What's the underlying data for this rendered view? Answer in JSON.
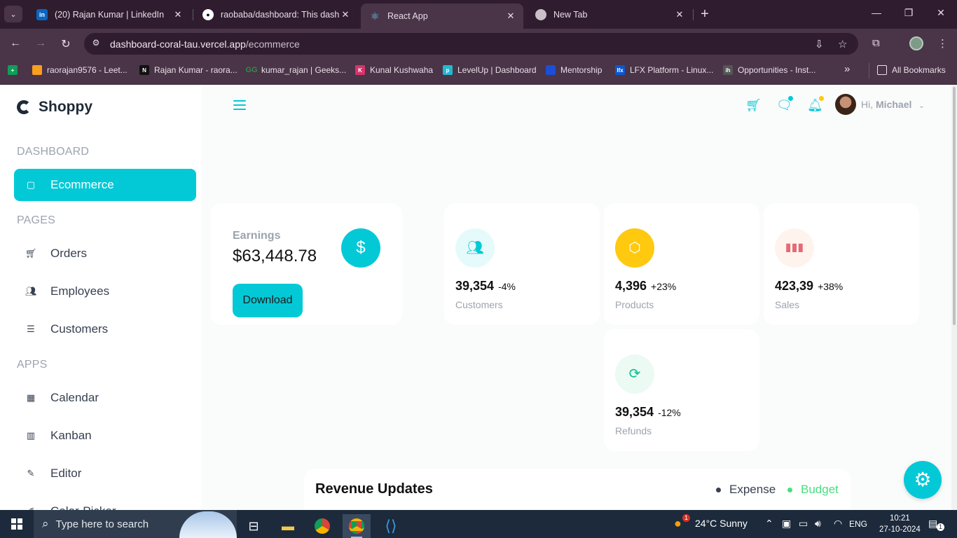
{
  "browser": {
    "tabs": [
      {
        "title": "(20) Rajan Kumar | LinkedIn",
        "icon": "linkedin-icon"
      },
      {
        "title": "raobaba/dashboard: This dashb",
        "icon": "github-icon"
      },
      {
        "title": "React App",
        "icon": "react-icon"
      },
      {
        "title": "New Tab",
        "icon": "chrome-icon"
      }
    ],
    "url_host": "dashboard-coral-tau.vercel.app",
    "url_path": "/ecommerce",
    "bookmarks": [
      {
        "label": "raorajan9576 - Leet...",
        "color": "#f89f1b"
      },
      {
        "label": "Rajan Kumar - raora...",
        "color": "#111111"
      },
      {
        "label": "kumar_rajan | Geeks...",
        "color": "#2f8d46"
      },
      {
        "label": "Kunal Kushwaha",
        "color": "#d6336c"
      },
      {
        "label": "LevelUp | Dashboard",
        "color": "#22b8cf"
      },
      {
        "label": "Mentorship",
        "color": "#1c4ed8"
      },
      {
        "label": "LFX Platform - Linux...",
        "color": "#0b57d0"
      },
      {
        "label": "Opportunities - Inst...",
        "color": "#555555"
      }
    ],
    "all_bookmarks": "All Bookmarks",
    "bm_overflow": "»"
  },
  "app": {
    "brand": "Shoppy",
    "sidebar": {
      "sections": {
        "dashboard": "DASHBOARD",
        "pages": "PAGES",
        "apps": "APPS"
      },
      "items": {
        "ecommerce": "Ecommerce",
        "orders": "Orders",
        "employees": "Employees",
        "customers": "Customers",
        "calendar": "Calendar",
        "kanban": "Kanban",
        "editor": "Editor",
        "color_picker": "Color-Picker"
      }
    },
    "navbar": {
      "greeting": "Hi,",
      "user": "Michael"
    },
    "earnings": {
      "label": "Earnings",
      "value": "$63,448.78",
      "button": "Download",
      "icon": "$"
    },
    "stats": [
      {
        "amount": "39,354",
        "percent": "-4%",
        "title": "Customers",
        "icon": "customers-icon",
        "icon_color": "#03c9d7",
        "icon_bg": "#e5fafb",
        "pct_color": "#111111"
      },
      {
        "amount": "4,396",
        "percent": "+23%",
        "title": "Products",
        "icon": "box-icon",
        "icon_color": "#ffffff",
        "icon_bg": "#fec90f",
        "pct_color": "#111111"
      },
      {
        "amount": "423,39",
        "percent": "+38%",
        "title": "Sales",
        "icon": "bar-chart-icon",
        "icon_color": "#e46a76",
        "icon_bg": "#fff4ed",
        "pct_color": "#111111"
      },
      {
        "amount": "39,354",
        "percent": "-12%",
        "title": "Refunds",
        "icon": "refresh-icon",
        "icon_color": "#00c292",
        "icon_bg": "#ebfaf2",
        "pct_color": "#111111"
      }
    ],
    "revenue": {
      "title": "Revenue Updates",
      "legend_expense": "Expense",
      "legend_budget": "Budget"
    },
    "colors": {
      "accent": "#03c9d7",
      "budget": "#4ade80",
      "expense": "#374151"
    }
  },
  "taskbar": {
    "search_placeholder": "Type here to search",
    "weather": "24°C  Sunny",
    "lang": "ENG",
    "time": "10:21",
    "date": "27-10-2024",
    "weather_badge": "1",
    "notif_badge": "1"
  }
}
